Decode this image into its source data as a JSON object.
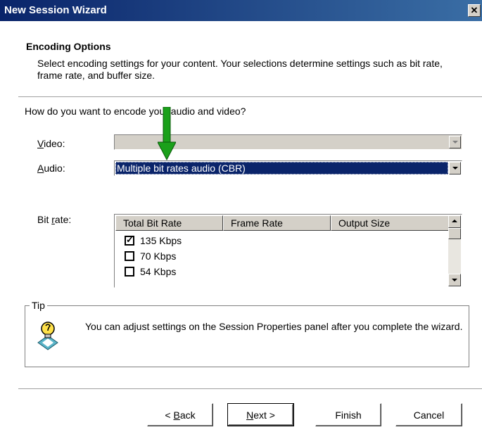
{
  "window": {
    "title": "New Session Wizard",
    "close_glyph": "✕"
  },
  "header": {
    "title": "Encoding Options",
    "description": "Select encoding settings for your content. Your selections determine settings such as bit rate, frame rate, and buffer size."
  },
  "question": "How do you want to encode your audio and video?",
  "video": {
    "label_first": "V",
    "label_rest": "ideo:",
    "value": ""
  },
  "audio": {
    "label_first": "A",
    "label_rest": "udio:",
    "value": "Multiple bit rates audio (CBR)"
  },
  "bitrate": {
    "label_first": "Bit ",
    "label_u": "r",
    "label_rest": "ate:",
    "columns": [
      "Total Bit Rate",
      "Frame Rate",
      "Output Size"
    ],
    "rows": [
      {
        "rate": "135 Kbps",
        "checked": true
      },
      {
        "rate": "70 Kbps",
        "checked": false
      },
      {
        "rate": "54 Kbps",
        "checked": false
      }
    ]
  },
  "tip": {
    "legend": "Tip",
    "icon": "lightbulb-icon",
    "text": "You can adjust settings on the Session Properties panel after you complete the wizard."
  },
  "buttons": {
    "back_prefix": "< ",
    "back_u": "B",
    "back_rest": "ack",
    "next_u": "N",
    "next_rest": "ext >",
    "finish": "Finish",
    "cancel": "Cancel"
  },
  "colors": {
    "selection": "#0a246a",
    "arrow": "#1aa01a",
    "face": "#d4d0c8"
  }
}
